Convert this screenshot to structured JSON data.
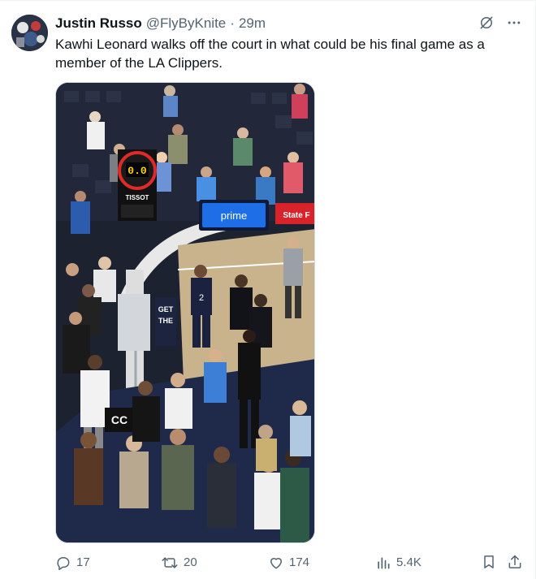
{
  "author": {
    "display_name": "Justin Russo",
    "handle": "@FlyByKnite",
    "separator": "·",
    "time": "29m"
  },
  "tweet": {
    "text": "Kawhi Leonard walks off the court in what could be his final game as a member of the LA Clippers."
  },
  "media": {
    "signage": {
      "prime": "prime",
      "statefarm": "State F",
      "tissot": "TISSOT",
      "get": "GET",
      "the": "THE",
      "jersey_number": "2",
      "courtside": "CC",
      "scoreboard": "0.0"
    }
  },
  "top_icons": [
    "grok-icon",
    "more-icon"
  ],
  "actions": {
    "replies": "17",
    "reposts": "20",
    "likes": "174",
    "views": "5.4K"
  },
  "colors": {
    "accent_text": "#0f1419",
    "secondary_text": "#536471",
    "border": "#cfd9de"
  }
}
